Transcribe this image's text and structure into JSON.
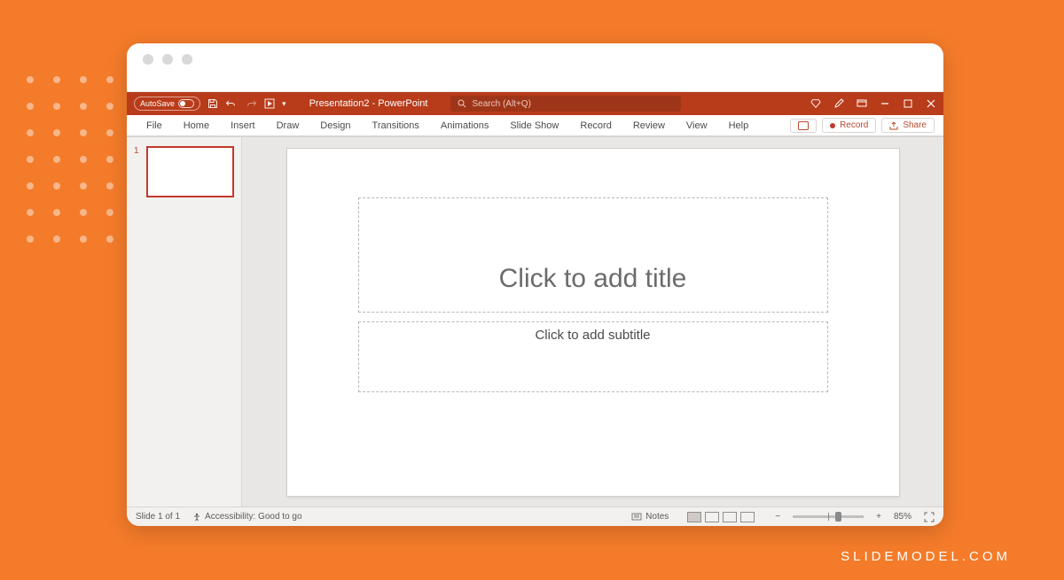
{
  "brand": "SLIDEMODEL.COM",
  "titlebar": {
    "autosave_label": "AutoSave",
    "doc_title": "Presentation2 - PowerPoint",
    "search_placeholder": "Search (Alt+Q)"
  },
  "ribbon": {
    "tabs": [
      "File",
      "Home",
      "Insert",
      "Draw",
      "Design",
      "Transitions",
      "Animations",
      "Slide Show",
      "Record",
      "Review",
      "View",
      "Help"
    ],
    "record_label": "Record",
    "share_label": "Share"
  },
  "thumbnails": {
    "slide1_number": "1"
  },
  "slide": {
    "title_placeholder": "Click to add title",
    "subtitle_placeholder": "Click to add subtitle"
  },
  "status": {
    "slide_counter": "Slide 1 of 1",
    "accessibility": "Accessibility: Good to go",
    "notes_label": "Notes",
    "zoom_percent": "85%"
  }
}
